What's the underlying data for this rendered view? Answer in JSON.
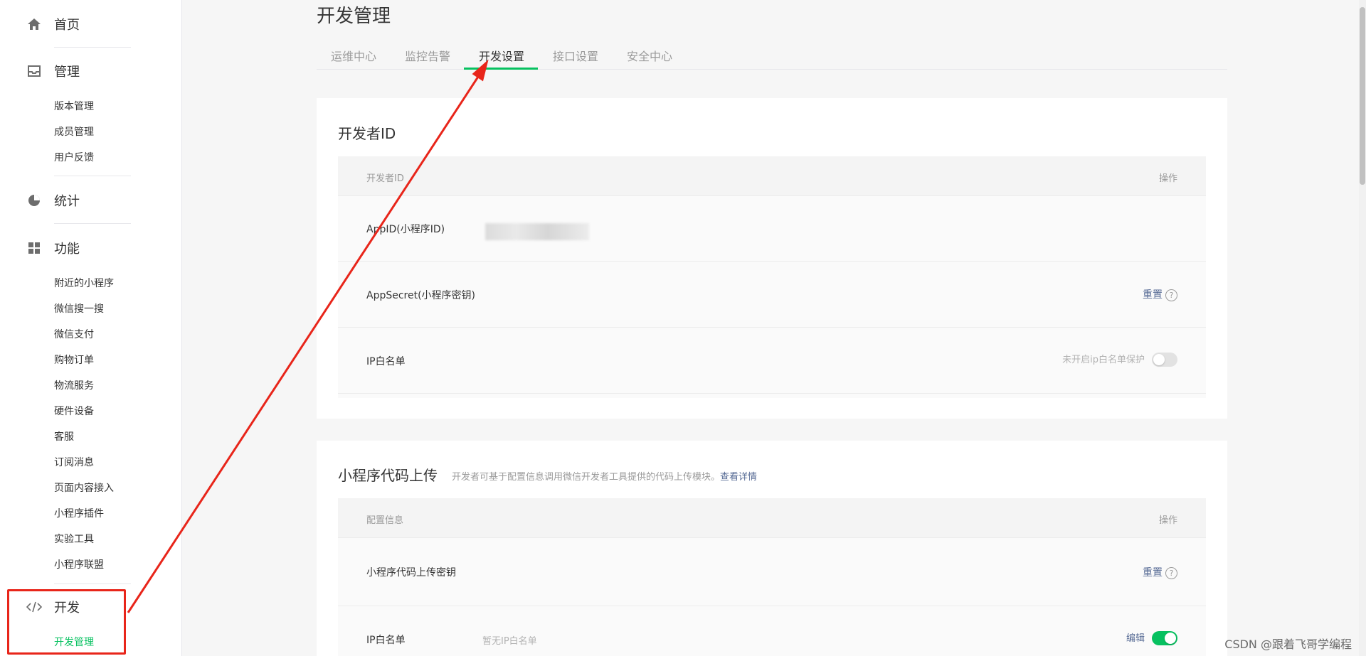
{
  "sidebar": {
    "home": "首页",
    "manage": "管理",
    "manage_items": [
      "版本管理",
      "成员管理",
      "用户反馈"
    ],
    "stats": "统计",
    "features": "功能",
    "feature_items": [
      "附近的小程序",
      "微信搜一搜",
      "微信支付",
      "购物订单",
      "物流服务",
      "硬件设备",
      "客服",
      "订阅消息",
      "页面内容接入",
      "小程序插件",
      "实验工具",
      "小程序联盟"
    ],
    "dev": "开发",
    "dev_items": [
      "开发管理"
    ]
  },
  "page_title": "开发管理",
  "tabs": [
    "运维中心",
    "监控告警",
    "开发设置",
    "接口设置",
    "安全中心"
  ],
  "active_tab": "开发设置",
  "developer_id": {
    "title": "开发者ID",
    "header": {
      "col1": "开发者ID",
      "col2": "操作"
    },
    "rows": [
      {
        "label": "AppID(小程序ID)",
        "value": ""
      },
      {
        "label": "AppSecret(小程序密钥)",
        "action": "重置",
        "help": "?"
      },
      {
        "label": "IP白名单",
        "status": "未开启ip白名单保护",
        "toggle_on": false
      }
    ]
  },
  "code_upload": {
    "title": "小程序代码上传",
    "desc": "开发者可基于配置信息调用微信开发者工具提供的代码上传模块。",
    "desc_link": "查看详情",
    "header": {
      "col1": "配置信息",
      "col2": "操作"
    },
    "rows": [
      {
        "label": "小程序代码上传密钥",
        "action": "重置",
        "help": "?"
      },
      {
        "label": "IP白名单",
        "value": "暂无IP白名单",
        "action": "编辑",
        "toggle_on": true
      }
    ]
  },
  "watermark": "CSDN @跟着飞哥学编程",
  "colors": {
    "accent": "#07c160",
    "link": "#576b95",
    "annotation": "#e8251a"
  }
}
